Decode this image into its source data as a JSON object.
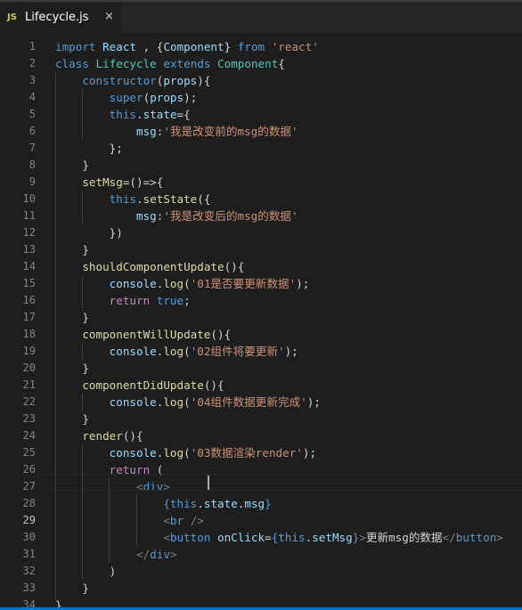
{
  "tab": {
    "icon": "JS",
    "filename": "Lifecycle.js",
    "close_glyph": "×"
  },
  "editor": {
    "active_line": 29,
    "lines": [
      [
        [
          "k",
          "import"
        ],
        [
          "p",
          " "
        ],
        [
          "v",
          "React"
        ],
        [
          "p",
          " , {"
        ],
        [
          "v",
          "Component"
        ],
        [
          "p",
          "} "
        ],
        [
          "k",
          "from"
        ],
        [
          "p",
          " "
        ],
        [
          "s",
          "'react'"
        ]
      ],
      [
        [
          "k",
          "class"
        ],
        [
          "p",
          " "
        ],
        [
          "cl",
          "Lifecycle"
        ],
        [
          "p",
          " "
        ],
        [
          "k",
          "extends"
        ],
        [
          "p",
          " "
        ],
        [
          "cl",
          "Component"
        ],
        [
          "p",
          "{"
        ]
      ],
      [
        [
          "p",
          "    "
        ],
        [
          "k",
          "constructor"
        ],
        [
          "p",
          "("
        ],
        [
          "v",
          "props"
        ],
        [
          "p",
          "){"
        ]
      ],
      [
        [
          "p",
          "        "
        ],
        [
          "k",
          "super"
        ],
        [
          "p",
          "("
        ],
        [
          "v",
          "props"
        ],
        [
          "p",
          ");"
        ]
      ],
      [
        [
          "p",
          "        "
        ],
        [
          "k",
          "this"
        ],
        [
          "p",
          "."
        ],
        [
          "v",
          "state"
        ],
        [
          "p",
          "={"
        ]
      ],
      [
        [
          "p",
          "            "
        ],
        [
          "v",
          "msg"
        ],
        [
          "p",
          ":"
        ],
        [
          "s",
          "'我是改变前的msg的数据'"
        ]
      ],
      [
        [
          "p",
          "        };"
        ]
      ],
      [
        [
          "p",
          "    }"
        ]
      ],
      [
        [
          "p",
          "    "
        ],
        [
          "fn",
          "setMsg"
        ],
        [
          "p",
          "=()=>{"
        ]
      ],
      [
        [
          "p",
          "        "
        ],
        [
          "k",
          "this"
        ],
        [
          "p",
          "."
        ],
        [
          "fn",
          "setState"
        ],
        [
          "p",
          "({"
        ]
      ],
      [
        [
          "p",
          "            "
        ],
        [
          "v",
          "msg"
        ],
        [
          "p",
          ":"
        ],
        [
          "s",
          "'我是改变后的msg的数据'"
        ]
      ],
      [
        [
          "p",
          "        })"
        ]
      ],
      [
        [
          "p",
          "    }"
        ]
      ],
      [
        [
          "p",
          "    "
        ],
        [
          "fn",
          "shouldComponentUpdate"
        ],
        [
          "p",
          "(){"
        ]
      ],
      [
        [
          "p",
          "        "
        ],
        [
          "v",
          "console"
        ],
        [
          "p",
          "."
        ],
        [
          "fn",
          "log"
        ],
        [
          "p",
          "("
        ],
        [
          "s",
          "'01是否要更新数据'"
        ],
        [
          "p",
          ");"
        ]
      ],
      [
        [
          "p",
          "        "
        ],
        [
          "ctl",
          "return"
        ],
        [
          "p",
          " "
        ],
        [
          "k",
          "true"
        ],
        [
          "p",
          ";"
        ]
      ],
      [
        [
          "p",
          "    }"
        ]
      ],
      [
        [
          "p",
          "    "
        ],
        [
          "fn",
          "componentWillUpdate"
        ],
        [
          "p",
          "(){"
        ]
      ],
      [
        [
          "p",
          "        "
        ],
        [
          "v",
          "console"
        ],
        [
          "p",
          "."
        ],
        [
          "fn",
          "log"
        ],
        [
          "p",
          "("
        ],
        [
          "s",
          "'02组件将要更新'"
        ],
        [
          "p",
          ");"
        ]
      ],
      [
        [
          "p",
          "    }"
        ]
      ],
      [
        [
          "p",
          "    "
        ],
        [
          "fn",
          "componentDidUpdate"
        ],
        [
          "p",
          "(){"
        ]
      ],
      [
        [
          "p",
          "        "
        ],
        [
          "v",
          "console"
        ],
        [
          "p",
          "."
        ],
        [
          "fn",
          "log"
        ],
        [
          "p",
          "("
        ],
        [
          "s",
          "'04组件数据更新完成'"
        ],
        [
          "p",
          ");"
        ]
      ],
      [
        [
          "p",
          "    }"
        ]
      ],
      [
        [
          "p",
          "    "
        ],
        [
          "fn",
          "render"
        ],
        [
          "p",
          "(){"
        ]
      ],
      [
        [
          "p",
          "        "
        ],
        [
          "v",
          "console"
        ],
        [
          "p",
          "."
        ],
        [
          "fn",
          "log"
        ],
        [
          "p",
          "("
        ],
        [
          "s",
          "'03数据渲染render'"
        ],
        [
          "p",
          ");"
        ]
      ],
      [
        [
          "p",
          "        "
        ],
        [
          "ctl",
          "return"
        ],
        [
          "p",
          " ("
        ]
      ],
      [
        [
          "p",
          "            "
        ],
        [
          "gy",
          "<"
        ],
        [
          "tg",
          "div"
        ],
        [
          "gy",
          ">"
        ]
      ],
      [
        [
          "p",
          "                "
        ],
        [
          "tg",
          "{"
        ],
        [
          "k",
          "this"
        ],
        [
          "p",
          "."
        ],
        [
          "v",
          "state"
        ],
        [
          "p",
          "."
        ],
        [
          "v",
          "msg"
        ],
        [
          "tg",
          "}"
        ]
      ],
      [
        [
          "p",
          "                "
        ],
        [
          "gy",
          "<"
        ],
        [
          "tg",
          "br"
        ],
        [
          "p",
          " "
        ],
        [
          "gy",
          "/>"
        ]
      ],
      [
        [
          "p",
          "                "
        ],
        [
          "gy",
          "<"
        ],
        [
          "tg",
          "button"
        ],
        [
          "p",
          " "
        ],
        [
          "at",
          "onClick"
        ],
        [
          "p",
          "="
        ],
        [
          "tg",
          "{"
        ],
        [
          "k",
          "this"
        ],
        [
          "p",
          "."
        ],
        [
          "v",
          "setMsg"
        ],
        [
          "tg",
          "}"
        ],
        [
          "gy",
          ">"
        ],
        [
          "tx",
          "更新msg的数据"
        ],
        [
          "gy",
          "</"
        ],
        [
          "tg",
          "button"
        ],
        [
          "gy",
          ">"
        ]
      ],
      [
        [
          "p",
          "            "
        ],
        [
          "gy",
          "</"
        ],
        [
          "tg",
          "div"
        ],
        [
          "gy",
          ">"
        ]
      ],
      [
        [
          "p",
          "        )"
        ]
      ],
      [
        [
          "p",
          "    }"
        ]
      ],
      [
        [
          "p",
          "}"
        ]
      ]
    ]
  }
}
